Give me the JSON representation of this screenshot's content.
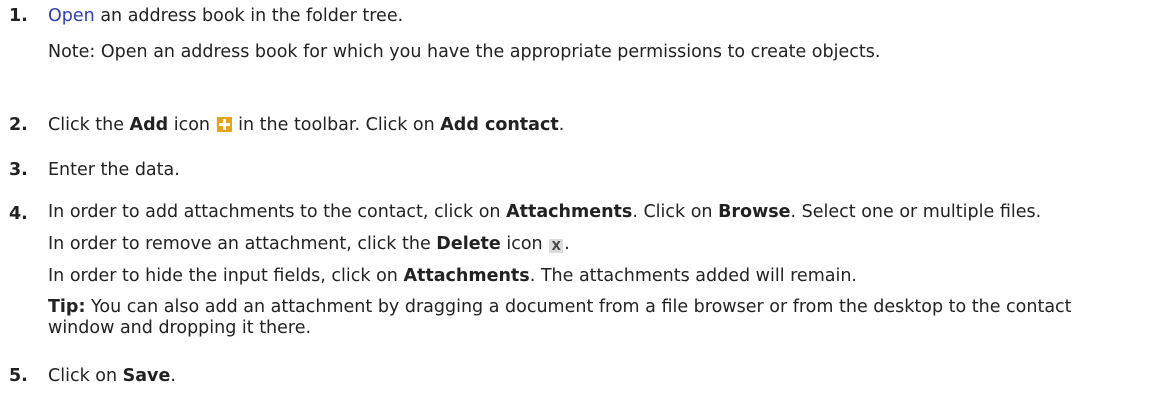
{
  "steps": [
    {
      "num": "1.",
      "link": "Open",
      "text": " an address book in the folder tree.",
      "note": "Note:  Open an address book for which you have the appropriate permissions to create objects."
    },
    {
      "num": "2.",
      "a": "Click the ",
      "b1": "Add",
      "c": " icon ",
      "icon": "add-icon",
      "d": " in the toolbar. Click on ",
      "b2": "Add contact",
      "e": "."
    },
    {
      "num": "3.",
      "text": "Enter the data."
    },
    {
      "num": "4.",
      "a": "In order to add attachments to the contact, click on ",
      "b1": "Attachments",
      "c": ". Click on ",
      "b2": "Browse",
      "d": ". Select one or multiple files.",
      "r_a": "In order to remove an attachment, click the ",
      "r_b": "Delete",
      "r_c": " icon ",
      "r_icon": "delete-icon",
      "r_d": ".",
      "h_a": "In order to hide the input fields, click on ",
      "h_b": "Attachments",
      "h_c": ". The attachments added will remain.",
      "tip_label": "Tip:",
      "tip_text": " You can also add an attachment by dragging a document from a file browser or from the desktop to the contact window and dropping it there."
    },
    {
      "num": "5.",
      "a": "Click on ",
      "b": "Save",
      "c": "."
    }
  ],
  "colors": {
    "link": "#2f3fb0",
    "add_icon": "#e8a317"
  }
}
